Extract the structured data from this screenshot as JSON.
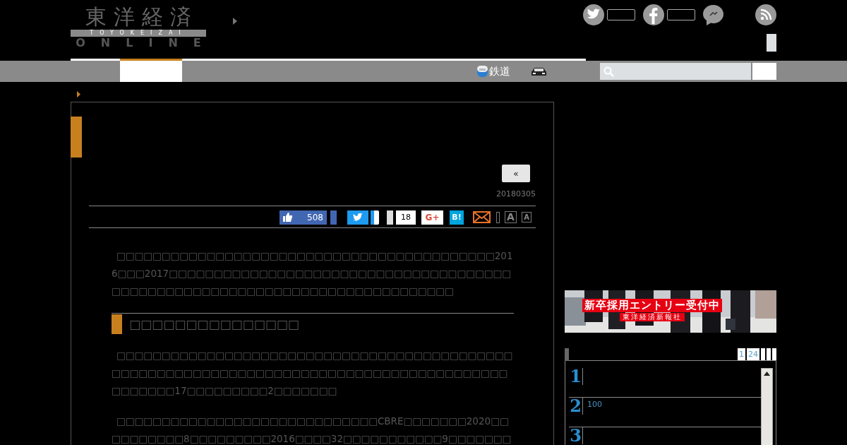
{
  "logo": {
    "title": "東洋経済",
    "subtitle": "TOYOKEIZAI",
    "tagline": "ONLINE"
  },
  "social": {
    "counts": [
      {
        "kind": "twitter"
      },
      {
        "kind": "facebook"
      },
      {
        "kind": "messenger"
      },
      {
        "kind": "rss"
      }
    ]
  },
  "nav": {
    "items": [
      {
        "kind": "blank_tab",
        "selected": true
      },
      {
        "kind": "train_link",
        "label": "鉄道"
      },
      {
        "kind": "car_link"
      }
    ],
    "search": {
      "kind": "search"
    }
  },
  "article": {
    "back_button": "«",
    "date": "20180305",
    "share": {
      "like_count": "508",
      "bookmark_count": "18",
      "gplus": "G+",
      "hatena": "B!",
      "font_large": "A",
      "font_small": "A"
    },
    "blocks": [
      {
        "kind": "paragraph",
        "text": "□□□□□□□□□□□□□□□□□□□□□□□□□□□□□□□□□□□□□□□□□□2016□□□2017□□□□□□□□□□□□□□□□□□□□□□□□□□□□□□□□□□□□□□□□□□□□□□□□□□□□□□□□□□□□□□□□□□□□□□□□□□□□"
      },
      {
        "kind": "heading",
        "text": "□□□□□□□□□□□□□□□"
      },
      {
        "kind": "paragraph",
        "text": "□□□□□□□□□□□□□□□□□□□□□□□□□□□□□□□□□□□□□□□□□□□□□□□□□□□□□□□□□□□□□□□□□□□□□□□□□□□□□□□□□□□□□□□□□□□□□□□17□□□□□□□□□2□□□□□□□"
      },
      {
        "kind": "paragraph",
        "text": "□□□□□□□□□□□□□□□□□□□□□□□□□□□□□CBRE□□□□□□□2020□□□□□□□□□□8□□□□□□□□□2016□□□□32□□□□□□□□□□□9□□□□□□□"
      }
    ]
  },
  "banner": {
    "headline": "新卒採用エントリー受付中",
    "company": "東洋経済新報社"
  },
  "ranking": {
    "tabs": [
      {
        "label": "1"
      },
      {
        "label": "24"
      }
    ],
    "rows": [
      {
        "rank": "1"
      },
      {
        "rank": "2",
        "text": "100"
      },
      {
        "rank": "3"
      }
    ]
  }
}
